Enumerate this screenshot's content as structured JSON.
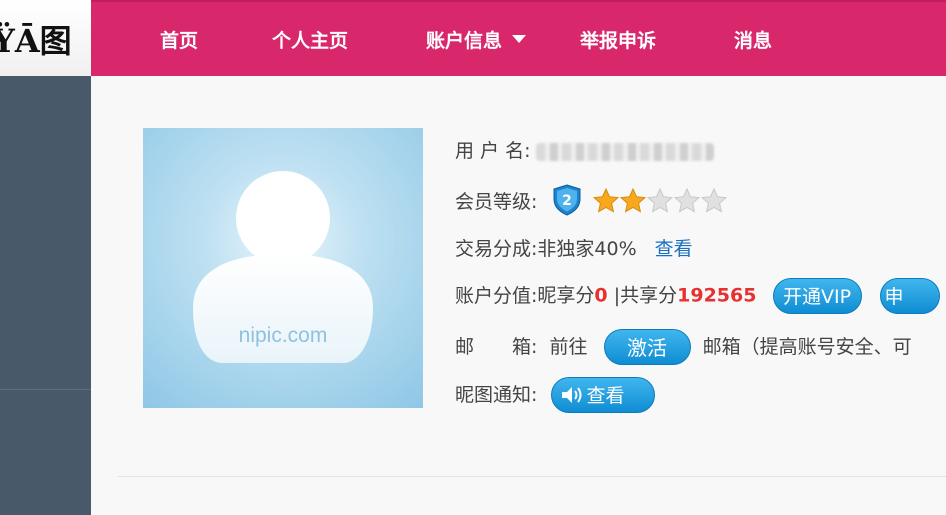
{
  "logo": {
    "text": "ŸĀ图"
  },
  "nav": {
    "items": [
      {
        "label": "首页"
      },
      {
        "label": "个人主页"
      },
      {
        "label": "账户信息"
      },
      {
        "label": "举报申诉"
      },
      {
        "label": "消息"
      }
    ]
  },
  "avatar": {
    "watermark": "nipic.com"
  },
  "profile": {
    "username_label": "用 户 名:",
    "member_level_label": "会员等级:",
    "member_level_number": "2",
    "stars_rating": 2,
    "stars_total": 5,
    "share_label": "交易分成:",
    "share_value": "非独家40%",
    "share_link": "查看",
    "points_label": "账户分值:",
    "points_nixiang_text": "昵享分",
    "points_nixiang_value": "0",
    "points_sep": "|",
    "points_gongxiang_text": "共享分",
    "points_gongxiang_value": "192565",
    "vip_button": "开通VIP",
    "next_button": "申",
    "email_label": "邮　　箱:",
    "email_prefix": "前往",
    "activate_button": "激活",
    "email_suffix": "邮箱（提高账号安全、可",
    "notice_label": "昵图通知:",
    "notice_button": "查看"
  },
  "colors": {
    "nav_bg": "#d9276c",
    "sidebar_bg": "#485a6a",
    "accent_blue": "#1a8fd6",
    "highlight_red": "#e8302f"
  }
}
